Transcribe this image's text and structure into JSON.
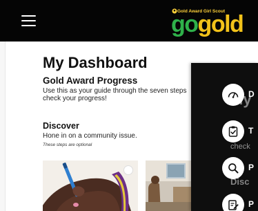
{
  "header": {
    "menu_icon": "hamburger-menu-icon",
    "logo": {
      "tagline": "Gold Award Girl Scout",
      "word_go": "go",
      "word_gold": "gold",
      "colors": {
        "go": "#2fb14a",
        "gold": "#f2c21a",
        "tagline": "#ffd23a"
      }
    },
    "background": "#050505"
  },
  "main": {
    "title": "My Dashboard",
    "progress": {
      "title": "Gold Award Progress",
      "description": "Use this as your guide through the seven steps check your progress!"
    },
    "discover": {
      "title": "Discover",
      "description": "Hone in on a community issue.",
      "note": "These steps are optional"
    },
    "cards": [
      {
        "image": "hand-writing-with-pen-photo"
      },
      {
        "image": "community-room-photo"
      }
    ]
  },
  "panel": {
    "background": "#0e0e0e",
    "ghost_text": [
      "My",
      "check",
      "Disc"
    ],
    "items": [
      {
        "icon": "gauge-icon",
        "label": "D"
      },
      {
        "icon": "clipboard-check-icon",
        "label": "T"
      },
      {
        "icon": "magnifier-icon",
        "label": "P"
      },
      {
        "icon": "edit-document-icon",
        "label": "P"
      }
    ]
  }
}
